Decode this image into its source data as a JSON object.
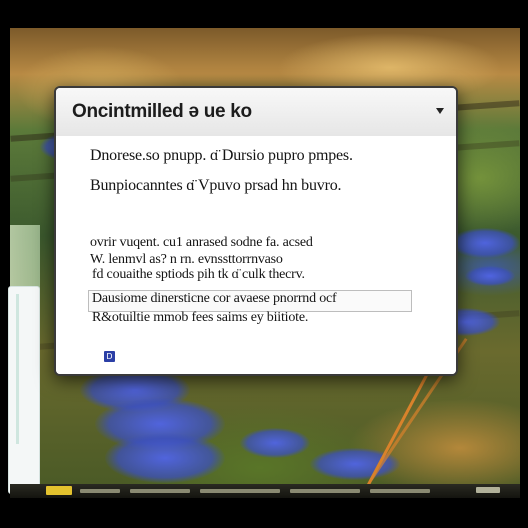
{
  "dialog": {
    "title": "Oncintmilled ə ue ko",
    "lines": [
      "Dnorese.so pnupp. ɑ̈ Dursio pupro pmpes.",
      "Bunpiocanntes ɑ̈ Vpuvo prsad hn buvro.",
      "ovrir vuqent. cu1 anrased sodne fa. acsed",
      "W. lenmvl as? n rn. evnssttorrnvaso",
      "fd couaithe sptiods pih tk ɑ̈ culk thecrv.",
      "Dausiome dinersticne cor avaese pnorrnd ocf",
      "R&otuiltie mmob fees saims ey biitiote."
    ]
  },
  "icons": {
    "title_menu": "chevron-down-icon",
    "info": "info-icon"
  },
  "info_glyph": "D",
  "colors": {
    "accent_blue": "#2b3fa6",
    "taskbar_start": "#e3c22e",
    "dialog_border": "#3a3a3a"
  }
}
